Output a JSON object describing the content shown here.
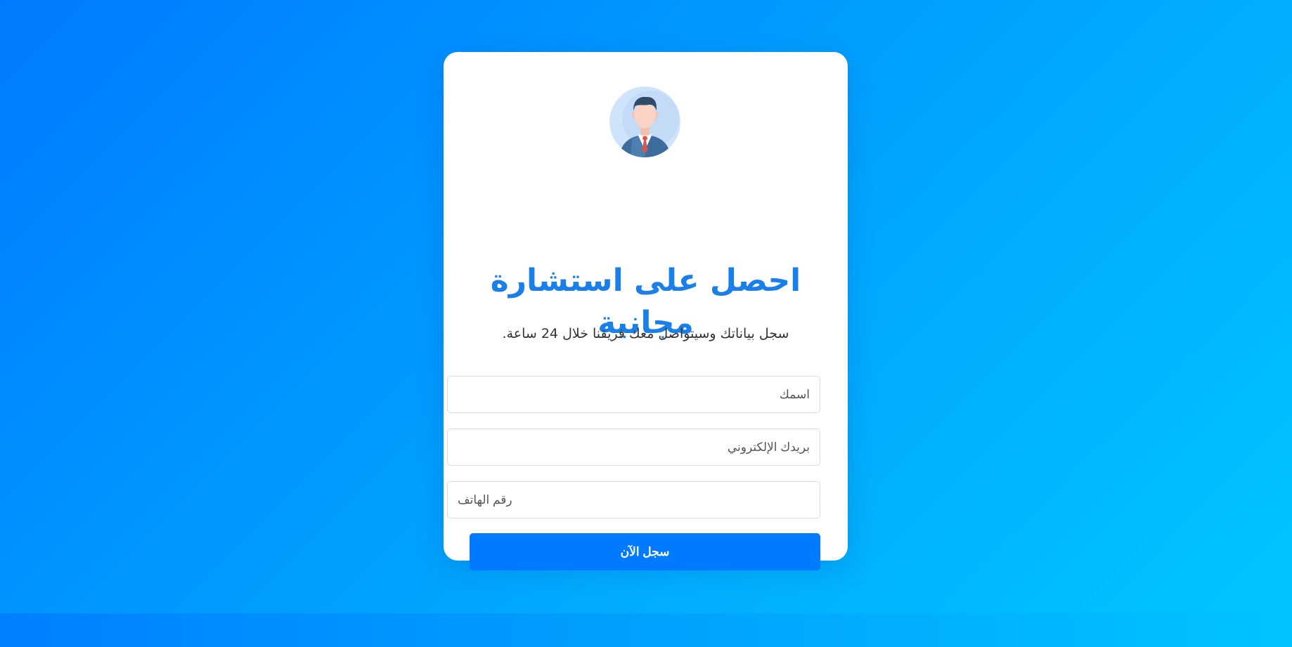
{
  "form": {
    "title": "احصل على استشارة مجانية",
    "subtitle": "سجل بياناتك وسيتواصل معك فريقنا خلال 24 ساعة.",
    "name_placeholder": "اسمك",
    "email_placeholder": "بريدك الإلكتروني",
    "phone_placeholder": "رقم الهاتف",
    "submit_label": "سجل الآن"
  },
  "colors": {
    "accent": "#007bff",
    "title": "#1a7fe8",
    "background_start": "#007bff",
    "background_end": "#00c6ff"
  },
  "icons": {
    "avatar": "businessman-avatar-icon"
  }
}
